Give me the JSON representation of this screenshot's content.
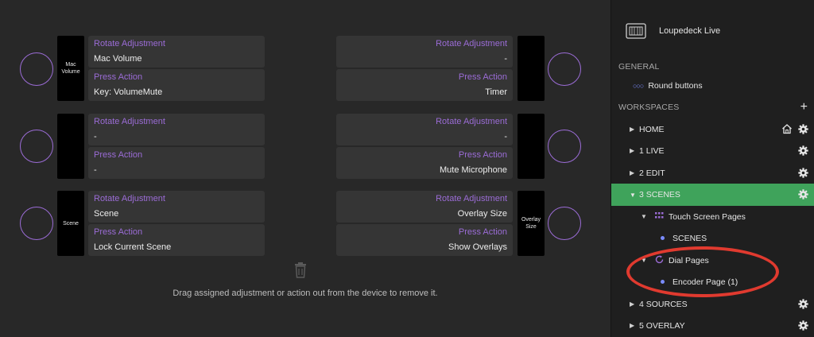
{
  "left_column": [
    {
      "screen_label": "Mac Volume",
      "rotate_label": "Rotate Adjustment",
      "rotate_value": "Mac Volume",
      "press_label": "Press Action",
      "press_value": "Key: VolumeMute"
    },
    {
      "screen_label": "",
      "rotate_label": "Rotate Adjustment",
      "rotate_value": "-",
      "press_label": "Press Action",
      "press_value": "-"
    },
    {
      "screen_label": "Scene",
      "rotate_label": "Rotate Adjustment",
      "rotate_value": "Scene",
      "press_label": "Press Action",
      "press_value": "Lock Current Scene"
    }
  ],
  "right_column": [
    {
      "screen_label": "",
      "rotate_label": "Rotate Adjustment",
      "rotate_value": "-",
      "press_label": "Press Action",
      "press_value": "Timer"
    },
    {
      "screen_label": "",
      "rotate_label": "Rotate Adjustment",
      "rotate_value": "-",
      "press_label": "Press Action",
      "press_value": "Mute Microphone"
    },
    {
      "screen_label": "Overlay Size",
      "rotate_label": "Rotate Adjustment",
      "rotate_value": "Overlay Size",
      "press_label": "Press Action",
      "press_value": "Show Overlays"
    }
  ],
  "hint": "Drag assigned adjustment or action out from the device to remove it.",
  "sidebar": {
    "device_name": "Loupedeck Live",
    "general_header": "GENERAL",
    "round_buttons": "Round buttons",
    "workspaces_header": "WORKSPACES",
    "workspaces": [
      {
        "label": "HOME"
      },
      {
        "label": "1 LIVE"
      },
      {
        "label": "2 EDIT"
      },
      {
        "label": "3 SCENES"
      },
      {
        "label": "Touch Screen Pages"
      },
      {
        "label": "SCENES"
      },
      {
        "label": "Dial Pages"
      },
      {
        "label": "Encoder Page (1)"
      },
      {
        "label": "4 SOURCES"
      },
      {
        "label": "5 OVERLAY"
      }
    ]
  },
  "colors": {
    "accent_purple": "#9b6cd6",
    "active_green": "#3fa35b",
    "annotation_red": "#e03a2f"
  }
}
